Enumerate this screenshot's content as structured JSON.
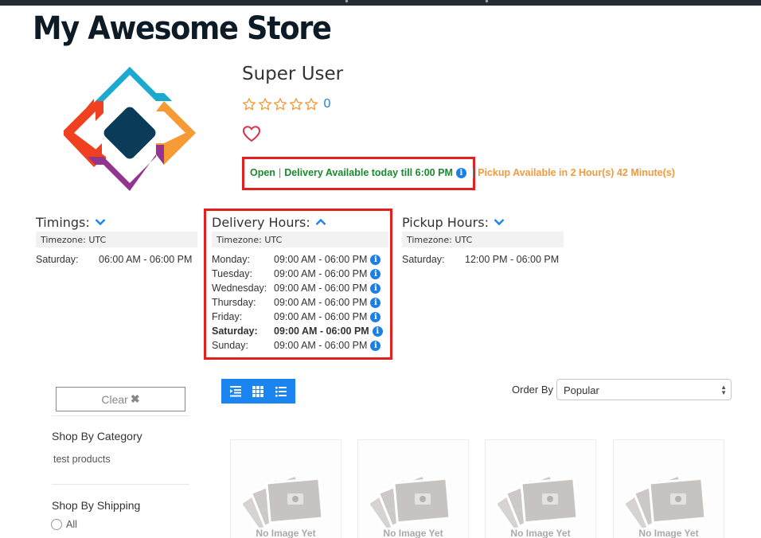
{
  "store": {
    "title": "My Awesome Store"
  },
  "profile": {
    "name": "Super User",
    "rating": {
      "stars_filled": 0,
      "stars_total": 5,
      "count": "0"
    }
  },
  "status": {
    "open_label": "Open",
    "delivery_text": "Delivery Available today till 6:00 PM",
    "pickup_text": "Pickup Available in 2 Hour(s) 42 Minute(s)",
    "colors": {
      "open": "#1a8a2c",
      "pickup": "#f39a3c",
      "highlight": "#e3201e"
    }
  },
  "timings": {
    "title": "Timings:",
    "timezone": "Timezone: UTC",
    "rows": [
      {
        "day": "Saturday:",
        "hours": "06:00 AM - 06:00 PM"
      }
    ]
  },
  "delivery_hours": {
    "title": "Delivery Hours:",
    "timezone": "Timezone: UTC",
    "rows": [
      {
        "day": "Monday:",
        "hours": "09:00 AM - 06:00 PM"
      },
      {
        "day": "Tuesday:",
        "hours": "09:00 AM - 06:00 PM"
      },
      {
        "day": "Wednesday:",
        "hours": "09:00 AM - 06:00 PM"
      },
      {
        "day": "Thursday:",
        "hours": "09:00 AM - 06:00 PM"
      },
      {
        "day": "Friday:",
        "hours": "09:00 AM - 06:00 PM"
      },
      {
        "day": "Saturday:",
        "hours": "09:00 AM - 06:00 PM",
        "current": true
      },
      {
        "day": "Sunday:",
        "hours": "09:00 AM - 06:00 PM"
      }
    ]
  },
  "pickup_hours": {
    "title": "Pickup Hours:",
    "timezone": "Timezone: UTC",
    "rows": [
      {
        "day": "Saturday:",
        "hours": "12:00 PM - 06:00 PM"
      }
    ]
  },
  "filters": {
    "clear_label": "Clear",
    "category_heading": "Shop By Category",
    "categories": [
      "test products"
    ],
    "shipping_heading": "Shop By Shipping",
    "shipping_options": [
      "All"
    ]
  },
  "toolbar": {
    "view_icons": [
      "indent-list-icon",
      "grid-icon",
      "list-icon"
    ],
    "accent": "#1a85f0",
    "order_label": "Order By",
    "order_value": "Popular"
  },
  "products": [
    {
      "placeholder": "No Image Yet"
    },
    {
      "placeholder": "No Image Yet"
    },
    {
      "placeholder": "No Image Yet"
    },
    {
      "placeholder": "No Image Yet"
    }
  ]
}
